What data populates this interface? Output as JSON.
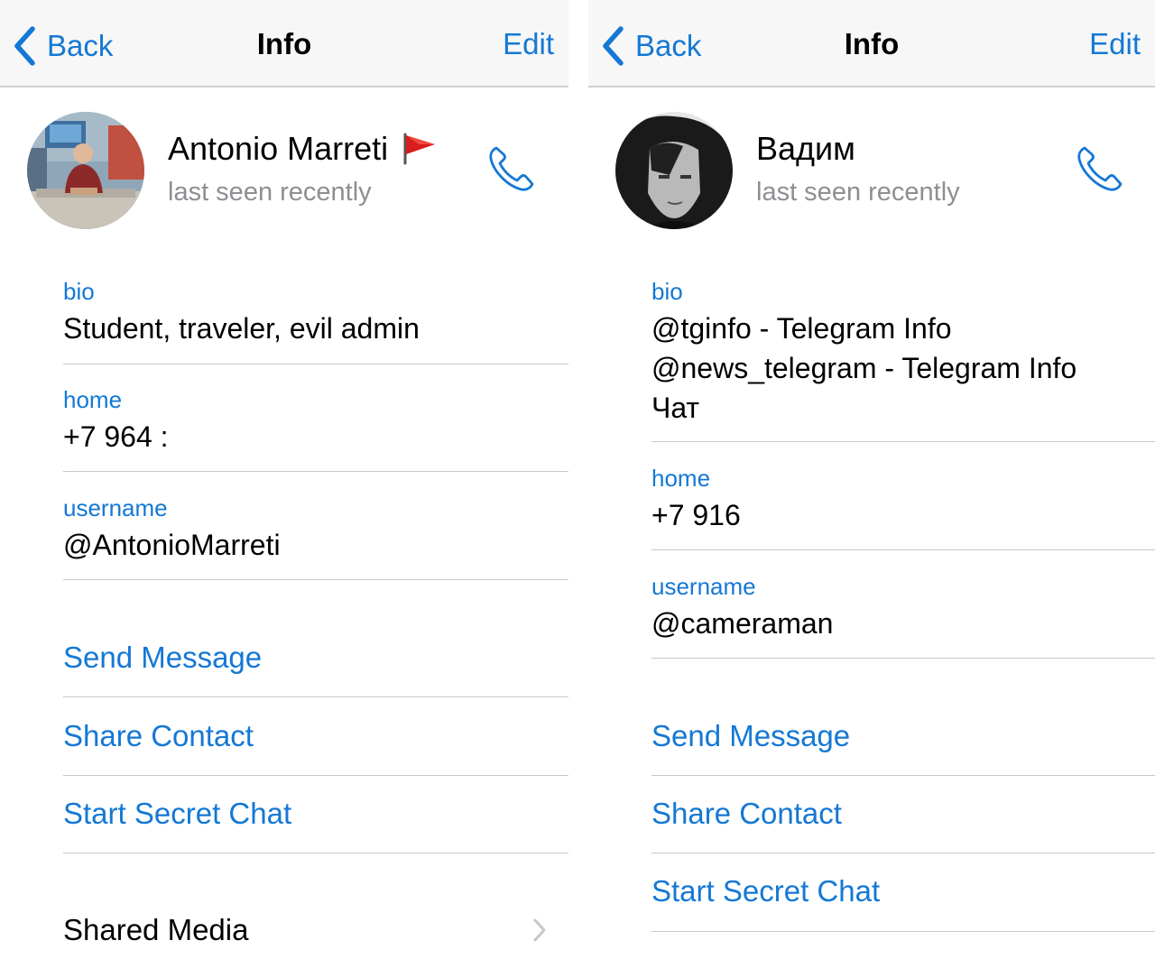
{
  "left": {
    "nav": {
      "back": "Back",
      "title": "Info",
      "edit": "Edit"
    },
    "profile": {
      "name": "Antonio Marreti",
      "status": "last seen recently"
    },
    "bio": {
      "label": "bio",
      "value": "Student, traveler, evil admin"
    },
    "home": {
      "label": "home",
      "value": "+7 964 :"
    },
    "username": {
      "label": "username",
      "value": "@AntonioMarreti"
    },
    "actions": {
      "send": "Send Message",
      "share": "Share Contact",
      "secret": "Start Secret Chat"
    },
    "shared_media": "Shared Media"
  },
  "right": {
    "nav": {
      "back": "Back",
      "title": "Info",
      "edit": "Edit"
    },
    "profile": {
      "name": "Вадим",
      "status": "last seen recently"
    },
    "bio": {
      "label": "bio",
      "line1": "@tginfo - Telegram Info",
      "line2": "@news_telegram - Telegram Info",
      "line3": "Чат"
    },
    "home": {
      "label": "home",
      "value": "+7 916"
    },
    "username": {
      "label": "username",
      "value": "@cameraman"
    },
    "actions": {
      "send": "Send Message",
      "share": "Share Contact",
      "secret": "Start Secret Chat"
    }
  },
  "colors": {
    "accent": "#1478d4",
    "secondary_text": "#8e8e93",
    "separator": "#c8c7cc",
    "navbar_bg": "#f7f7f7",
    "flag_red": "#d91c1c"
  },
  "icons": [
    "chevron-left-icon",
    "phone-icon",
    "flag-icon",
    "chevron-right-icon"
  ]
}
